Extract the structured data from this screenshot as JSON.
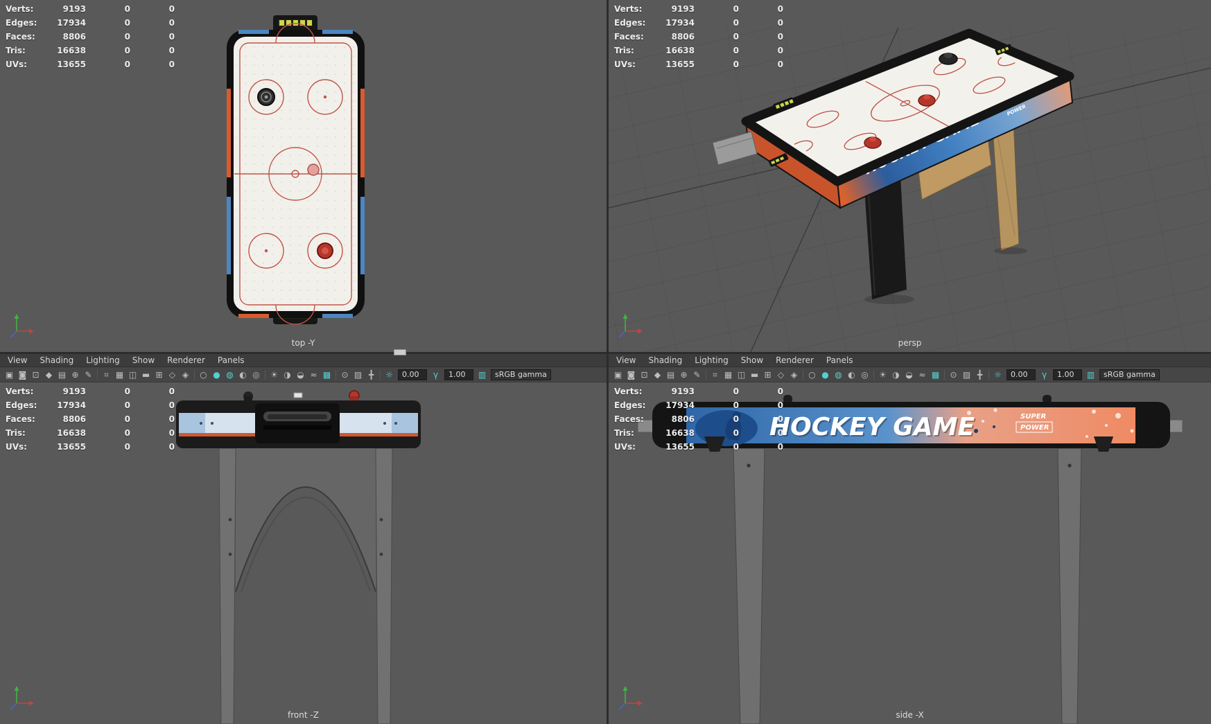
{
  "stats": {
    "rows": [
      {
        "label": "Verts:",
        "value": "9193",
        "c2": "0",
        "c3": "0"
      },
      {
        "label": "Edges:",
        "value": "17934",
        "c2": "0",
        "c3": "0"
      },
      {
        "label": "Faces:",
        "value": "8806",
        "c2": "0",
        "c3": "0"
      },
      {
        "label": "Tris:",
        "value": "16638",
        "c2": "0",
        "c3": "0"
      },
      {
        "label": "UVs:",
        "value": "13655",
        "c2": "0",
        "c3": "0"
      }
    ]
  },
  "menus": [
    "View",
    "Shading",
    "Lighting",
    "Show",
    "Renderer",
    "Panels"
  ],
  "toolbar": {
    "icons": [
      "▣",
      "◙",
      "⊡",
      "◆",
      "▤",
      "⊕",
      "✎",
      "⌗",
      "▦",
      "◫",
      "▬",
      "⊞",
      "◇",
      "◈",
      "○",
      "●",
      "◍",
      "◐",
      "◎",
      "☀",
      "◑",
      "◒",
      "≈",
      "▩",
      "⊙",
      "▨",
      "╋",
      "☼",
      "γ",
      "▥"
    ],
    "exposure": "0.00",
    "gamma": "1.00",
    "view_transform": "sRGB gamma"
  },
  "viewports": {
    "top": {
      "label": "top -Y"
    },
    "persp": {
      "label": "persp"
    },
    "front": {
      "label": "front -Z"
    },
    "side": {
      "label": "side -X"
    }
  },
  "model": {
    "banner_title": "HOCKEY GAME",
    "banner_sub1": "SUPER",
    "banner_sub2": "POWER"
  },
  "colors": {
    "viewport_bg": "#595959",
    "accent_teal": "#56d0cd",
    "table_orange": "#d95b2d",
    "table_blue": "#4c86c2",
    "marking_red": "#c0544a"
  }
}
